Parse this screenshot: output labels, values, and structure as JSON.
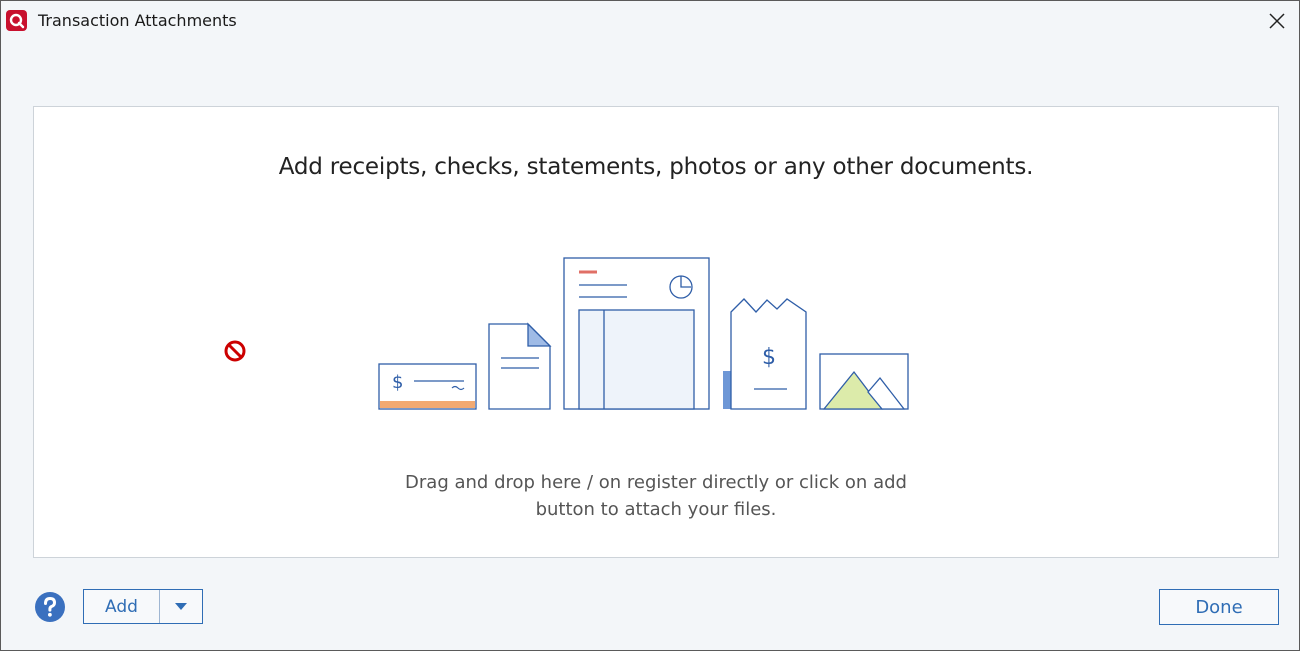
{
  "window": {
    "title": "Transaction Attachments",
    "logo_icon": "quicken-logo",
    "close_icon": "close-icon"
  },
  "drop_area": {
    "headline": "Add receipts, checks, statements, photos or any other documents.",
    "instructions_line1": "Drag and drop here / on register directly or click on add",
    "instructions_line2": "button to attach your files.",
    "illustration_items": [
      "check",
      "document",
      "statement",
      "receipt",
      "photo"
    ]
  },
  "footer": {
    "help_icon": "help-icon",
    "add_label": "Add",
    "add_dropdown_icon": "caret-down-icon",
    "done_label": "Done"
  },
  "colors": {
    "brand_red": "#c8102e",
    "accent_blue": "#2f6db5",
    "panel_border": "#cdd3d9",
    "background": "#f3f6f9",
    "no_drop_red": "#cc0000"
  }
}
